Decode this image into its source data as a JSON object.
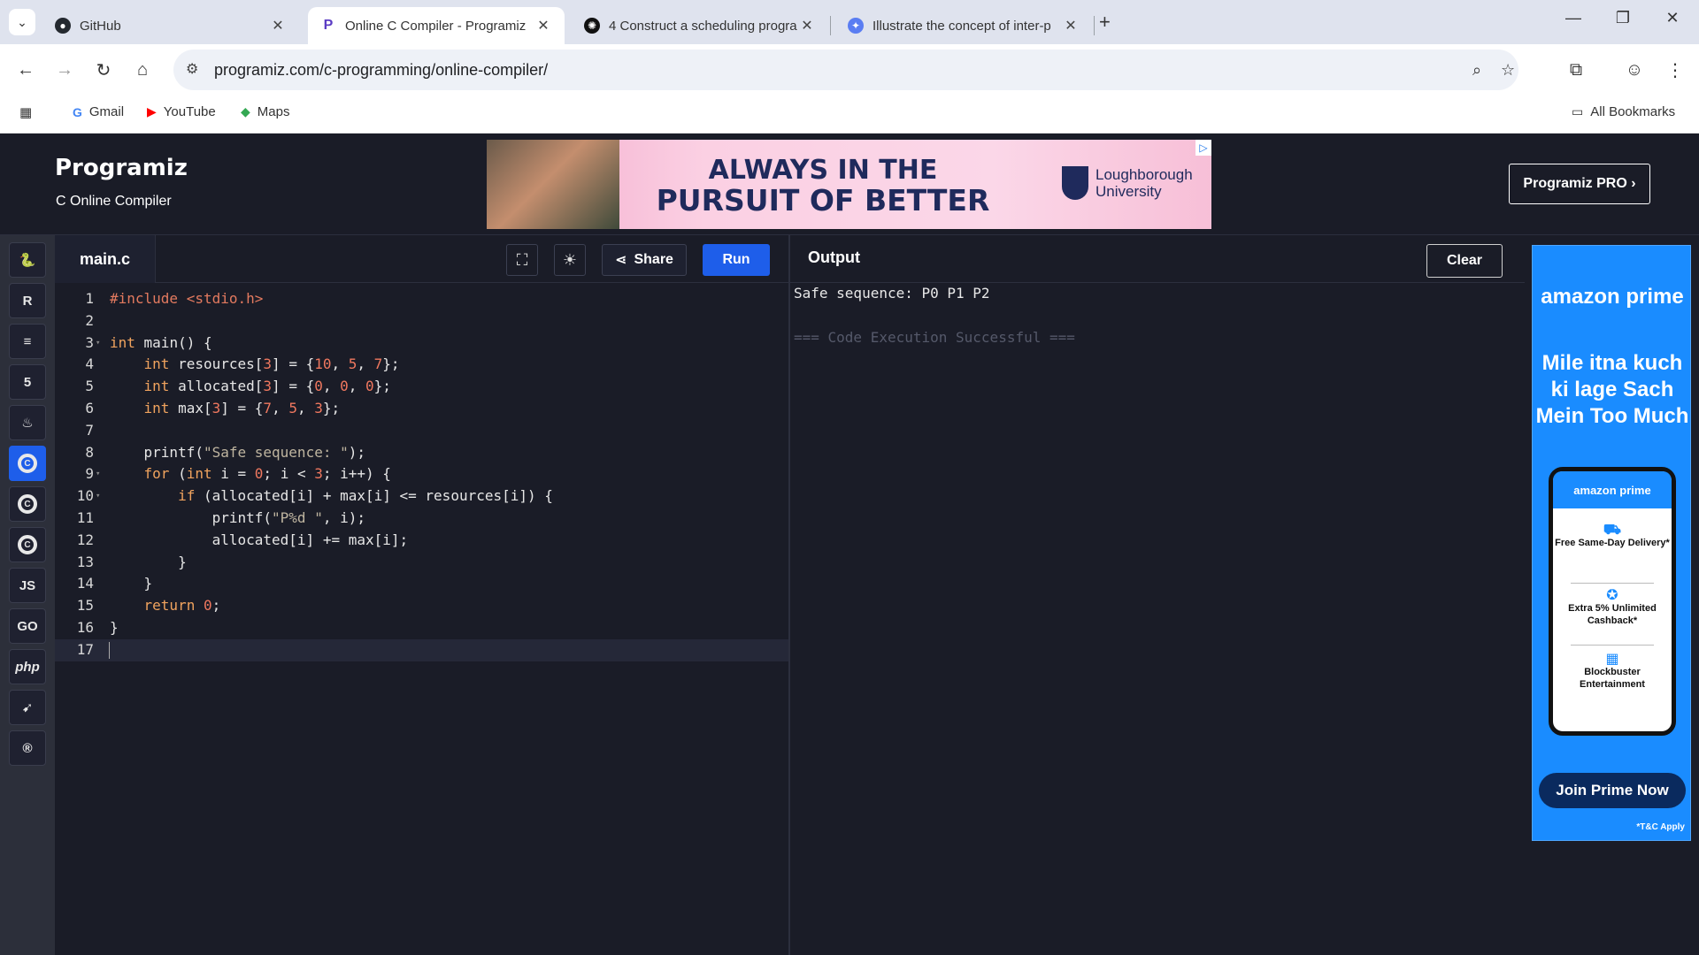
{
  "browser": {
    "tabs": [
      {
        "title": "GitHub",
        "favicon": "github-icon"
      },
      {
        "title": "Online C Compiler - Programiz",
        "favicon": "programiz-icon"
      },
      {
        "title": "4 Construct a scheduling progra",
        "favicon": "openai-icon"
      },
      {
        "title": "Illustrate the concept of inter-p",
        "favicon": "gemini-icon"
      }
    ],
    "url": "programiz.com/c-programming/online-compiler/",
    "bookmarks": [
      {
        "label": "Gmail",
        "icon": "google-icon"
      },
      {
        "label": "YouTube",
        "icon": "youtube-icon"
      },
      {
        "label": "Maps",
        "icon": "maps-icon"
      }
    ],
    "all_bookmarks": "All Bookmarks"
  },
  "header": {
    "logo": "Programiz",
    "subtitle": "C Online Compiler",
    "ad": {
      "line1": "ALWAYS IN THE",
      "line2": "PURSUIT OF BETTER",
      "university_line1": "Loughborough",
      "university_line2": "University"
    },
    "pro_button": "Programiz PRO ›"
  },
  "rail": [
    {
      "name": "python",
      "glyph": "🐍"
    },
    {
      "name": "r",
      "glyph": "R"
    },
    {
      "name": "sql",
      "glyph": "≡"
    },
    {
      "name": "html",
      "glyph": "5"
    },
    {
      "name": "java",
      "glyph": "♨"
    },
    {
      "name": "c",
      "glyph": "C",
      "active": true
    },
    {
      "name": "cpp",
      "glyph": "C"
    },
    {
      "name": "csharp",
      "glyph": "C"
    },
    {
      "name": "javascript",
      "glyph": "JS"
    },
    {
      "name": "go",
      "glyph": "GO"
    },
    {
      "name": "php",
      "glyph": "php"
    },
    {
      "name": "swift",
      "glyph": "➹"
    },
    {
      "name": "rust",
      "glyph": "®"
    }
  ],
  "editor": {
    "file_name": "main.c",
    "share_label": "Share",
    "run_label": "Run",
    "lines": [
      "#include <stdio.h>",
      "",
      "int main() {",
      "    int resources[3] = {10, 5, 7};",
      "    int allocated[3] = {0, 0, 0};",
      "    int max[3] = {7, 5, 3};",
      "",
      "    printf(\"Safe sequence: \");",
      "    for (int i = 0; i < 3; i++) {",
      "        if (allocated[i] + max[i] <= resources[i]) {",
      "            printf(\"P%d \", i);",
      "            allocated[i] += max[i];",
      "        }",
      "    }",
      "    return 0;",
      "}",
      ""
    ],
    "fold_lines": [
      3,
      9,
      10
    ],
    "current_line": 17
  },
  "output": {
    "title": "Output",
    "clear_label": "Clear",
    "result": "Safe sequence: P0 P1 P2",
    "status": "=== Code Execution Successful ==="
  },
  "side_ad": {
    "logo": "amazon prime",
    "headline": "Mile itna kuch ki lage Sach Mein Too Much",
    "phone_header": "amazon prime",
    "features": [
      "Free Same-Day Delivery*",
      "Extra 5% Unlimited Cashback*",
      "Blockbuster Entertainment"
    ],
    "cta": "Join Prime Now",
    "tc": "*T&C Apply"
  }
}
